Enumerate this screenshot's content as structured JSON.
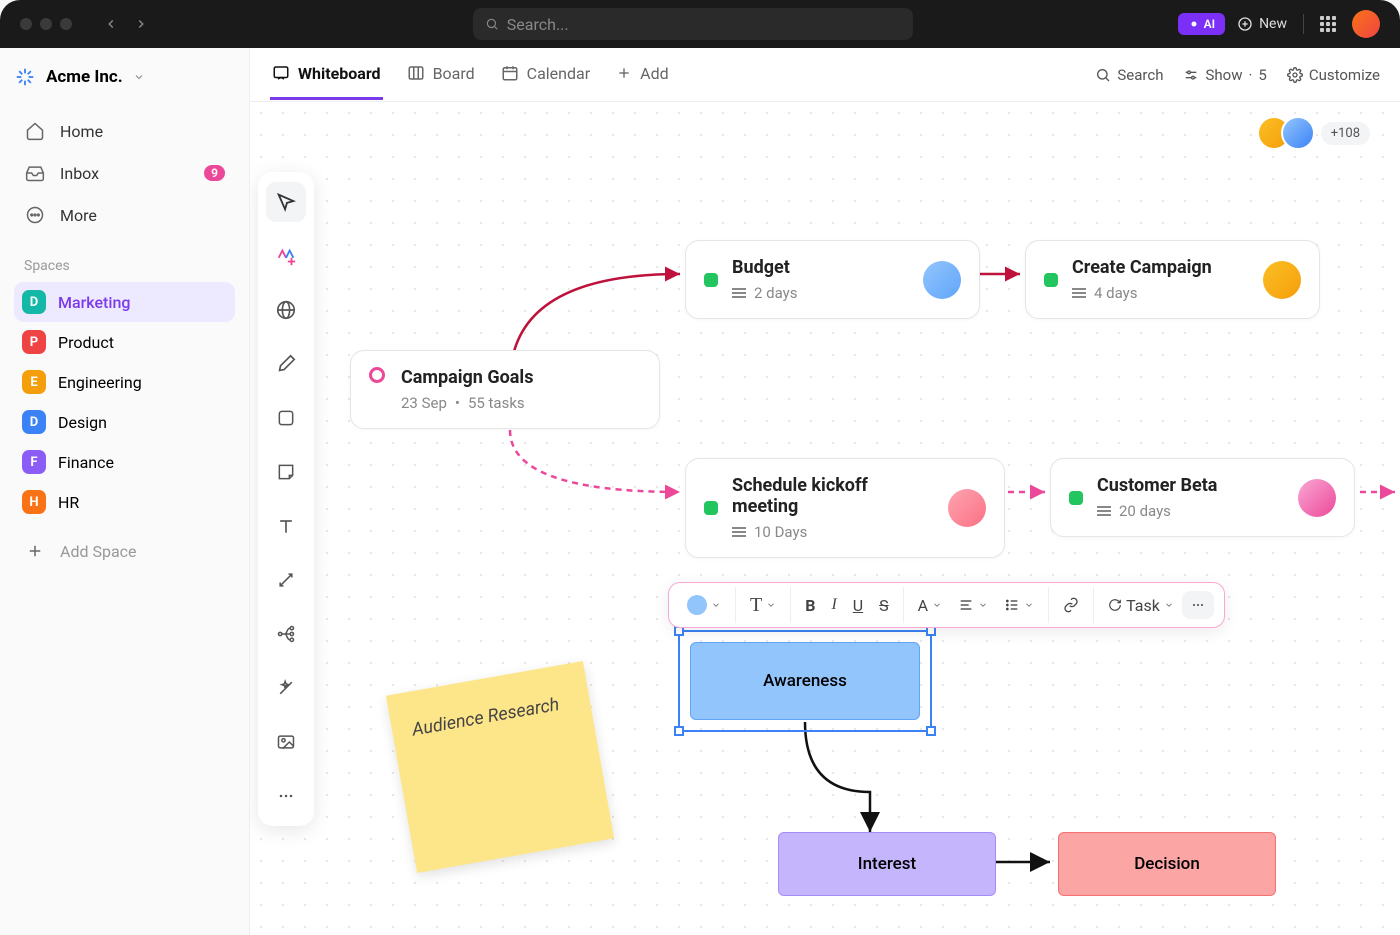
{
  "titlebar": {
    "search_placeholder": "Search...",
    "ai_label": "AI",
    "new_label": "New"
  },
  "workspace": {
    "name": "Acme Inc."
  },
  "nav": {
    "home": "Home",
    "inbox": "Inbox",
    "inbox_count": "9",
    "more": "More"
  },
  "spaces_label": "Spaces",
  "spaces": [
    {
      "letter": "D",
      "color": "#14b8a6",
      "label": "Marketing",
      "active": true
    },
    {
      "letter": "P",
      "color": "#ef4444",
      "label": "Product"
    },
    {
      "letter": "E",
      "color": "#f59e0b",
      "label": "Engineering"
    },
    {
      "letter": "D",
      "color": "#3b82f6",
      "label": "Design"
    },
    {
      "letter": "F",
      "color": "#8b5cf6",
      "label": "Finance"
    },
    {
      "letter": "H",
      "color": "#f97316",
      "label": "HR"
    }
  ],
  "add_space_label": "Add Space",
  "tabs": {
    "whiteboard": "Whiteboard",
    "board": "Board",
    "calendar": "Calendar",
    "add": "Add"
  },
  "toolbar_right": {
    "search": "Search",
    "show": "Show",
    "show_count": "5",
    "customize": "Customize"
  },
  "collab_more": "+108",
  "cards": {
    "goals": {
      "title": "Campaign Goals",
      "date": "23 Sep",
      "tasks": "55 tasks"
    },
    "budget": {
      "title": "Budget",
      "duration": "2 days"
    },
    "campaign": {
      "title": "Create Campaign",
      "duration": "4 days"
    },
    "kickoff": {
      "title": "Schedule kickoff meeting",
      "duration": "10 Days"
    },
    "beta": {
      "title": "Customer Beta",
      "duration": "20 days"
    }
  },
  "sticky": {
    "text": "Audience Research"
  },
  "shapes": {
    "awareness": "Awareness",
    "interest": "Interest",
    "decision": "Decision"
  },
  "fmt_toolbar": {
    "task_label": "Task"
  }
}
